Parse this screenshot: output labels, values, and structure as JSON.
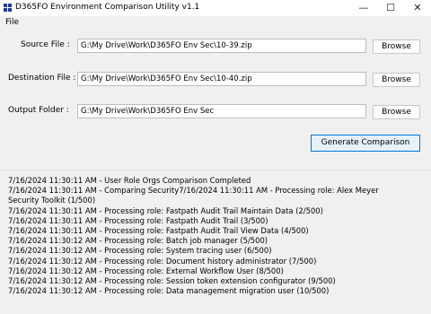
{
  "window": {
    "title": "D365FO Environment Comparison Utility v1.1",
    "minimize_glyph": "—",
    "maximize_glyph": "☐",
    "close_glyph": "✕",
    "icon": "app-grid-icon"
  },
  "menu": {
    "file": "File"
  },
  "form": {
    "source_label": "Source File :",
    "source_value": "G:\\My Drive\\Work\\D365FO Env Sec\\10-39.zip",
    "destination_label": "Destination File :",
    "destination_value": "G:\\My Drive\\Work\\D365FO Env Sec\\10-40.zip",
    "output_label": "Output Folder :",
    "output_value": "G:\\My Drive\\Work\\D365FO Env Sec",
    "browse_label": "Browse",
    "generate_label": "Generate Comparison"
  },
  "log": [
    "7/16/2024 11:30:11 AM - User Role Orgs Comparison Completed",
    "7/16/2024 11:30:11 AM - Comparing Security7/16/2024 11:30:11 AM - Processing role: Alex Meyer",
    "Security Toolkit (1/500)",
    "7/16/2024 11:30:11 AM - Processing role: Fastpath Audit Trail Maintain Data (2/500)",
    "7/16/2024 11:30:11 AM - Processing role: Fastpath Audit Trail (3/500)",
    "7/16/2024 11:30:11 AM - Processing role: Fastpath Audit Trail View Data (4/500)",
    "7/16/2024 11:30:12 AM - Processing role: Batch job manager (5/500)",
    "7/16/2024 11:30:12 AM - Processing role: System tracing user (6/500)",
    "7/16/2024 11:30:12 AM - Processing role: Document history administrator (7/500)",
    "7/16/2024 11:30:12 AM - Processing role: External Workflow User (8/500)",
    "7/16/2024 11:30:12 AM - Processing role: Session token extension configurator (9/500)",
    "7/16/2024 11:30:12 AM - Processing role: Data management migration user (10/500)"
  ],
  "colors": {
    "accent": "#0078d7",
    "button_bg": "#e5f1fb",
    "window_bg": "#f0f0f0"
  }
}
